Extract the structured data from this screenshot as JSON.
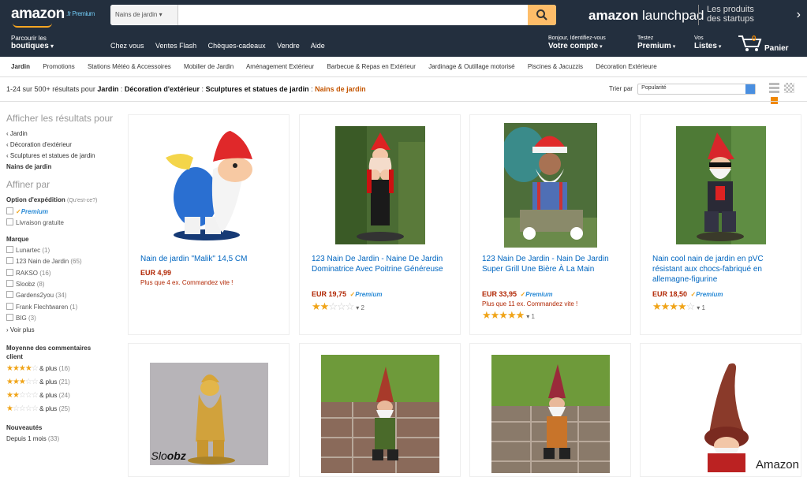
{
  "header": {
    "logo": "amazon",
    "logo_suffix": ".fr Premium",
    "search_category": "Nains de jardin",
    "search_value": "",
    "launchpad_a": "amazon",
    "launchpad_b": "launchpad",
    "promo_line1": "Les produits",
    "promo_line2": "des startups",
    "shop_line1": "Parcourir les",
    "shop_line2": "boutiques",
    "nav": [
      "Chez vous",
      "Ventes Flash",
      "Chèques-cadeaux",
      "Vendre",
      "Aide"
    ],
    "account_line1": "Bonjour, Identifiez-vous",
    "account_line2": "Votre compte",
    "premium_line1": "Testez",
    "premium_line2": "Premium",
    "lists_line1": "Vos",
    "lists_line2": "Listes",
    "cart_count": "0",
    "cart_label": "Panier"
  },
  "subnav": [
    "Jardin",
    "Promotions",
    "Stations Météo & Accessoires",
    "Mobilier de Jardin",
    "Aménagement Extérieur",
    "Barbecue & Repas en Extérieur",
    "Jardinage & Outillage motorisé",
    "Piscines & Jacuzzis",
    "Décoration Extérieure"
  ],
  "breadcrumb": {
    "prefix": "1-24 sur 500+ résultats pour",
    "p1": "Jardin",
    "p2": "Décoration d'extérieur",
    "p3": "Sculptures et statues de jardin",
    "p4": "Nains de jardin",
    "sep": " : "
  },
  "sort": {
    "label": "Trier par",
    "value": "Popularité"
  },
  "sidebar": {
    "show_results": "Afficher les résultats pour",
    "cats": [
      "‹ Jardin",
      "‹ Décoration d'extérieur",
      "‹ Sculptures et statues de jardin"
    ],
    "current": "Nains de jardin",
    "refine": "Affiner par",
    "shipping_title": "Option d'expédition",
    "shipping_help": "(Qu'est-ce?)",
    "prime": "Premium",
    "free_ship": "Livraison gratuite",
    "brand_title": "Marque",
    "brands": [
      {
        "name": "Lunartec",
        "count": "(1)"
      },
      {
        "name": "123 Nain de Jardin",
        "count": "(65)"
      },
      {
        "name": "RAKSO",
        "count": "(16)"
      },
      {
        "name": "Sloobz",
        "count": "(8)"
      },
      {
        "name": "Gardens2you",
        "count": "(34)"
      },
      {
        "name": "Frank Flechtwaren",
        "count": "(1)"
      },
      {
        "name": "BIG",
        "count": "(3)"
      }
    ],
    "see_more": "› Voir plus",
    "reviews_title": "Moyenne des commentaires client",
    "reviews": [
      {
        "stars": 4,
        "label": "& plus",
        "count": "(16)"
      },
      {
        "stars": 3,
        "label": "& plus",
        "count": "(21)"
      },
      {
        "stars": 2,
        "label": "& plus",
        "count": "(24)"
      },
      {
        "stars": 1,
        "label": "& plus",
        "count": "(25)"
      }
    ],
    "new_title": "Nouveautés",
    "new_item": "Depuis 1 mois",
    "new_count": "(33)"
  },
  "products": [
    {
      "title": "Nain de jardin \"Malik\" 14,5 CM",
      "price": "EUR 4,99",
      "prime": false,
      "stock": "Plus que 4 ex. Commandez vite !",
      "rating": null,
      "reviews": ""
    },
    {
      "title": "123 Nain De Jardin - Naine De Jardin Dominatrice Avec Poitrine Généreuse",
      "price": "EUR 19,75",
      "prime": true,
      "stock": "",
      "rating": 2,
      "reviews": "2"
    },
    {
      "title": "123 Nain De Jardin - Nain De Jardin Super Grill Une Bière À La Main",
      "price": "EUR 33,95",
      "prime": true,
      "stock": "Plus que 11 ex. Commandez vite !",
      "rating": 5,
      "reviews": "1"
    },
    {
      "title": "Nain cool nain de jardin en pVC résistant aux chocs-fabriqué en allemagne-figurine",
      "price": "EUR 18,50",
      "prime": true,
      "stock": "",
      "rating": 4,
      "reviews": "1"
    }
  ],
  "colors": {
    "nav_bg": "#232f3e",
    "link": "#0066c0",
    "price": "#b12704",
    "star": "#f0a418",
    "search_btn": "#febd69"
  },
  "watermark": "Amazon"
}
